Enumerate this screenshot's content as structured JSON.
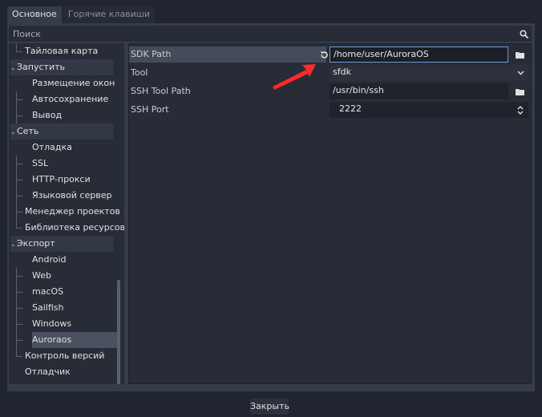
{
  "tabs": [
    {
      "label": "Основное",
      "active": true
    },
    {
      "label": "Горячие клавиши",
      "active": false
    }
  ],
  "search": {
    "placeholder": "Поиск",
    "icon": "magnifier-icon"
  },
  "tree": [
    {
      "label": "Тайловая карта",
      "type": "leaf",
      "name": "tree-item-tilemap"
    },
    {
      "label": "Запустить",
      "type": "category",
      "name": "tree-category-run"
    },
    {
      "label": "Размещение окон",
      "type": "leaf",
      "name": "tree-item-window-placement"
    },
    {
      "label": "Автосохранение",
      "type": "leaf",
      "name": "tree-item-autosave"
    },
    {
      "label": "Вывод",
      "type": "leaf",
      "name": "tree-item-output"
    },
    {
      "label": "Сеть",
      "type": "category",
      "name": "tree-category-network"
    },
    {
      "label": "Отладка",
      "type": "leaf",
      "name": "tree-item-debug"
    },
    {
      "label": "SSL",
      "type": "leaf",
      "name": "tree-item-ssl"
    },
    {
      "label": "HTTP-прокси",
      "type": "leaf",
      "name": "tree-item-http-proxy"
    },
    {
      "label": "Языковой сервер",
      "type": "leaf",
      "name": "tree-item-language-server"
    },
    {
      "label": "Менеджер проектов",
      "type": "section",
      "name": "tree-item-project-manager"
    },
    {
      "label": "Библиотека ресурсов",
      "type": "section",
      "name": "tree-item-asset-library"
    },
    {
      "label": "Экспорт",
      "type": "category",
      "name": "tree-category-export"
    },
    {
      "label": "Android",
      "type": "leaf",
      "name": "tree-item-android"
    },
    {
      "label": "Web",
      "type": "leaf",
      "name": "tree-item-web"
    },
    {
      "label": "macOS",
      "type": "leaf",
      "name": "tree-item-macos"
    },
    {
      "label": "Sailfish",
      "type": "leaf",
      "name": "tree-item-sailfish"
    },
    {
      "label": "Windows",
      "type": "leaf",
      "name": "tree-item-windows"
    },
    {
      "label": "Auroraos",
      "type": "leaf",
      "selected": true,
      "name": "tree-item-auroraos"
    },
    {
      "label": "Контроль версий",
      "type": "section",
      "name": "tree-item-version-control"
    },
    {
      "label": "Отладчик",
      "type": "section",
      "name": "tree-item-debugger"
    }
  ],
  "properties": [
    {
      "label": "SDK Path",
      "value": "/home/user/AuroraOS",
      "kind": "path",
      "highlighted": true,
      "revert_icon": "revert-icon",
      "button_icon": "folder-icon"
    },
    {
      "label": "Tool",
      "value": "sfdk",
      "kind": "dropdown",
      "arrow_icon": "chevron-down-icon"
    },
    {
      "label": "SSH Tool Path",
      "value": "/usr/bin/ssh",
      "kind": "path",
      "button_icon": "folder-icon"
    },
    {
      "label": "SSH Port",
      "value": "2222",
      "kind": "spinbox",
      "arrow_icon": "updown-icon"
    }
  ],
  "close_label": "Закрыть",
  "colors": {
    "background": "#202531",
    "panel": "#363d4a",
    "field": "#272c37",
    "focus_border": "#6d9ad6",
    "annotation_arrow": "#ff2a2a"
  }
}
